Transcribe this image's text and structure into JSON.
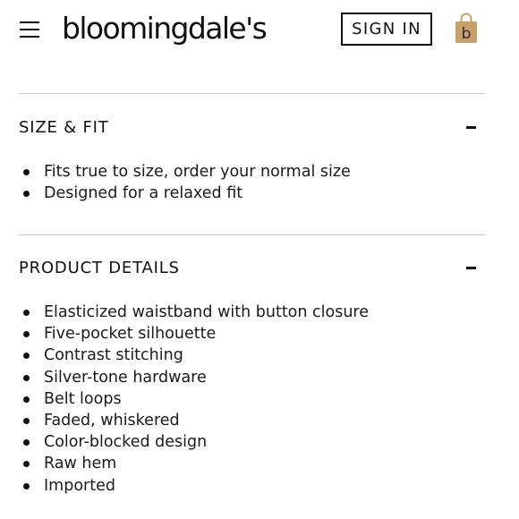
{
  "header": {
    "menu_icon": "hamburger-menu-icon",
    "logo_text": "bloomingdale's",
    "signin_label": "SIGN IN",
    "bag_icon": "shopping-bag-icon",
    "bag_letter": "b",
    "bag_color": "#c9a06a"
  },
  "sections": {
    "size_fit": {
      "title": "SIZE & FIT",
      "toggle_icon": "minus-collapse-icon",
      "items": [
        "Fits true to size, order your normal size",
        "Designed for a relaxed fit"
      ]
    },
    "product_details": {
      "title": "PRODUCT DETAILS",
      "toggle_icon": "minus-collapse-icon",
      "items": [
        "Elasticized waistband with button closure",
        "Five-pocket silhouette",
        "Contrast stitching",
        "Silver-tone hardware",
        "Belt loops",
        "Faded, whiskered",
        "Color-blocked design",
        "Raw hem",
        "Imported"
      ]
    }
  }
}
